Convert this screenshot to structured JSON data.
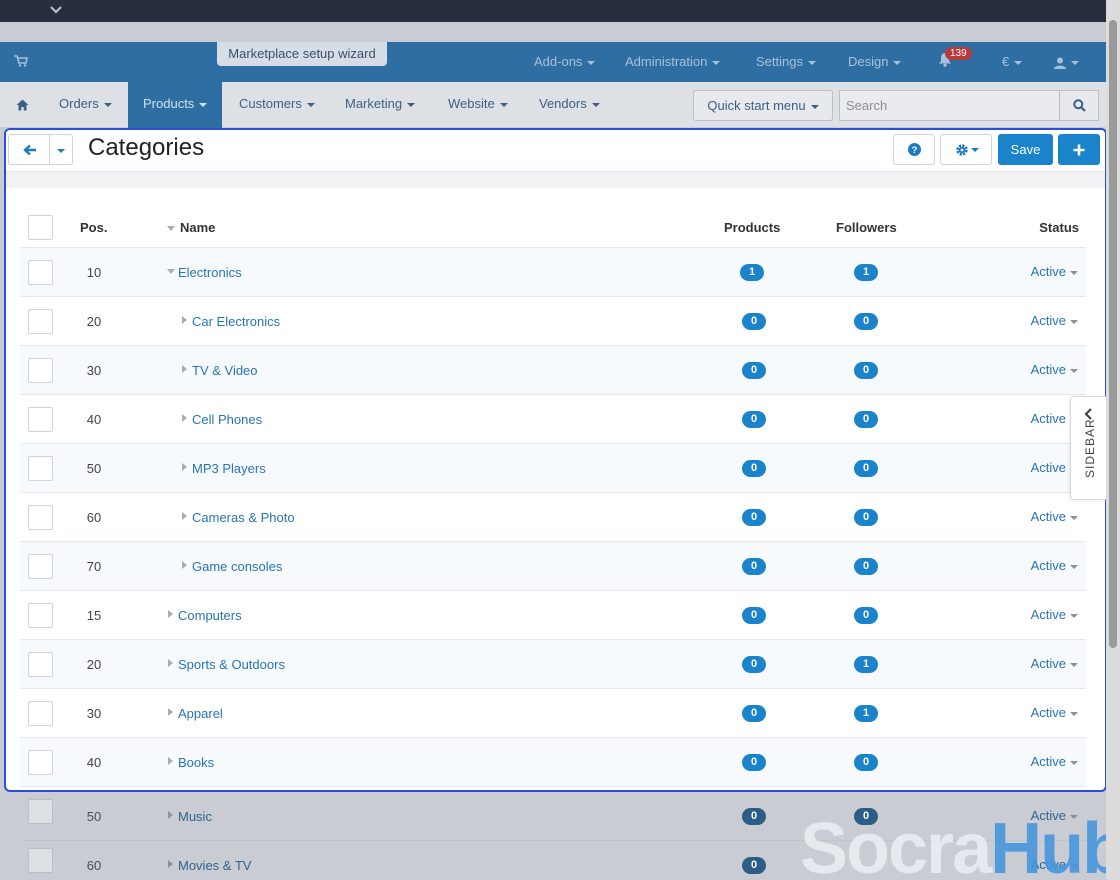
{
  "header": {
    "wizard_label": "Marketplace setup wizard",
    "nav": [
      "Add-ons",
      "Administration",
      "Settings",
      "Design"
    ],
    "notification_count": "139",
    "currency": "€"
  },
  "nav2": {
    "items": [
      "Orders",
      "Products",
      "Customers",
      "Marketing",
      "Website",
      "Vendors"
    ],
    "active": "Products",
    "quick_start": "Quick start menu",
    "search_placeholder": "Search"
  },
  "page": {
    "title": "Categories",
    "save_label": "Save",
    "sidebar_label": "SIDEBAR"
  },
  "table": {
    "headers": {
      "pos": "Pos.",
      "name": "Name",
      "products": "Products",
      "followers": "Followers",
      "status": "Status"
    },
    "rows": [
      {
        "pos": "10",
        "name": "Electronics",
        "level": 0,
        "expanded": true,
        "products": "1",
        "followers": "1",
        "status": "Active"
      },
      {
        "pos": "20",
        "name": "Car Electronics",
        "level": 1,
        "expanded": false,
        "products": "0",
        "followers": "0",
        "status": "Active"
      },
      {
        "pos": "30",
        "name": "TV & Video",
        "level": 1,
        "expanded": false,
        "products": "0",
        "followers": "0",
        "status": "Active"
      },
      {
        "pos": "40",
        "name": "Cell Phones",
        "level": 1,
        "expanded": false,
        "products": "0",
        "followers": "0",
        "status": "Active"
      },
      {
        "pos": "50",
        "name": "MP3 Players",
        "level": 1,
        "expanded": false,
        "products": "0",
        "followers": "0",
        "status": "Active"
      },
      {
        "pos": "60",
        "name": "Cameras & Photo",
        "level": 1,
        "expanded": false,
        "products": "0",
        "followers": "0",
        "status": "Active"
      },
      {
        "pos": "70",
        "name": "Game consoles",
        "level": 1,
        "expanded": false,
        "products": "0",
        "followers": "0",
        "status": "Active"
      },
      {
        "pos": "15",
        "name": "Computers",
        "level": 0,
        "expanded": false,
        "products": "0",
        "followers": "0",
        "status": "Active"
      },
      {
        "pos": "20",
        "name": "Sports & Outdoors",
        "level": 0,
        "expanded": false,
        "products": "0",
        "followers": "1",
        "status": "Active"
      },
      {
        "pos": "30",
        "name": "Apparel",
        "level": 0,
        "expanded": false,
        "products": "0",
        "followers": "1",
        "status": "Active"
      },
      {
        "pos": "40",
        "name": "Books",
        "level": 0,
        "expanded": false,
        "products": "0",
        "followers": "0",
        "status": "Active"
      }
    ],
    "dimmed_rows": [
      {
        "pos": "50",
        "name": "Music",
        "products": "0",
        "followers": "0",
        "status": "Active"
      },
      {
        "pos": "60",
        "name": "Movies & TV",
        "products": "0",
        "followers": "",
        "status": "Active"
      }
    ]
  },
  "watermark": {
    "part1": "Socra",
    "part2": "Hub"
  },
  "colors": {
    "accent": "#1a83c9",
    "header": "#2f6ea3",
    "highlight_border": "#2f4bd9",
    "link": "#2874b3"
  }
}
